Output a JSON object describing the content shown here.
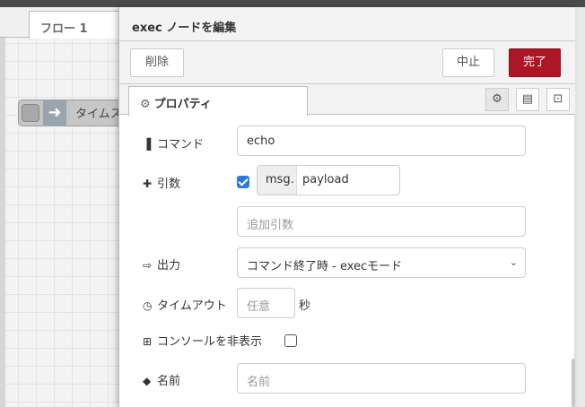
{
  "workspace": {
    "flow_tab": "フロー 1",
    "node_label": "タイムス",
    "node_icon": "arrow-right-icon"
  },
  "tray": {
    "title": "exec ノードを編集",
    "buttons": {
      "delete": "削除",
      "cancel": "中止",
      "done": "完了"
    },
    "tabs": {
      "properties": "プロパティ"
    },
    "colors": {
      "done_button": "#ad1625",
      "checkbox": "#2a7ae2"
    }
  },
  "form": {
    "command": {
      "label": "コマンド",
      "value": "echo"
    },
    "append": {
      "label": "引数",
      "checked": true,
      "type_prefix": "msg.",
      "type_value": "payload"
    },
    "extra_args": {
      "placeholder": "追加引数"
    },
    "output": {
      "label": "出力",
      "selected": "コマンド終了時 - execモード"
    },
    "timeout": {
      "label": "タイムアウト",
      "placeholder": "任意",
      "unit": "秒"
    },
    "hide_console": {
      "label": "コンソールを非表示",
      "checked": false
    },
    "name": {
      "label": "名前",
      "placeholder": "名前"
    }
  }
}
